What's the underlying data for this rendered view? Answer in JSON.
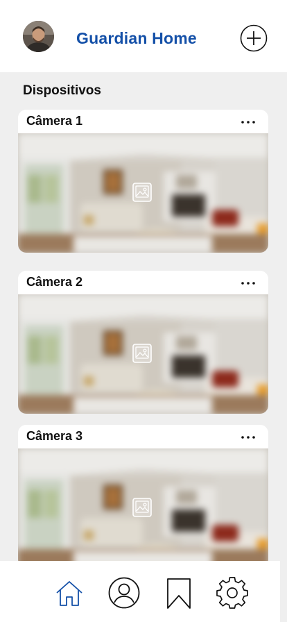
{
  "header": {
    "title": "Guardian Home",
    "avatar_icon": "user-photo",
    "add_icon": "plus-circle-icon"
  },
  "section": {
    "title": "Dispositivos"
  },
  "cameras": [
    {
      "label": "Câmera 1",
      "menu_icon": "more-horizontal-icon",
      "placeholder_icon": "image-icon"
    },
    {
      "label": "Câmera 2",
      "menu_icon": "more-horizontal-icon",
      "placeholder_icon": "image-icon"
    },
    {
      "label": "Câmera 3",
      "menu_icon": "more-horizontal-icon",
      "placeholder_icon": "image-icon"
    }
  ],
  "nav": {
    "items": [
      {
        "icon": "home-icon",
        "active": true
      },
      {
        "icon": "profile-icon",
        "active": false
      },
      {
        "icon": "bookmark-icon",
        "active": false
      },
      {
        "icon": "settings-icon",
        "active": false
      }
    ]
  },
  "colors": {
    "accent": "#1450a8",
    "background": "#efefef",
    "card": "#ffffff"
  }
}
